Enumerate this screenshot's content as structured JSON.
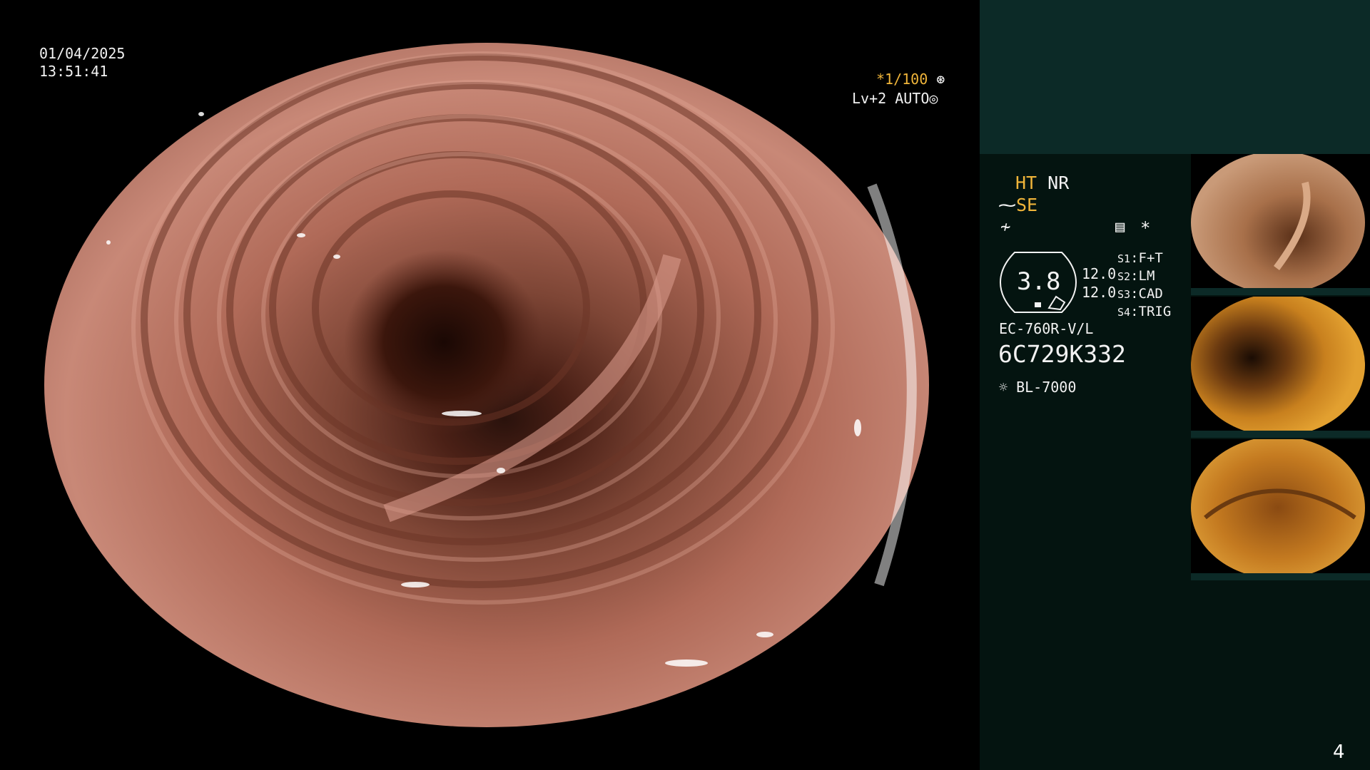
{
  "datetime": {
    "date": "01/04/2025",
    "time": "13:51:41"
  },
  "shutter": {
    "value": "1/100",
    "prefix": "*"
  },
  "level": {
    "label": "Lv+2",
    "mode": "AUTO"
  },
  "image_mode": {
    "ht": "HT",
    "nr": "NR",
    "se": "SE"
  },
  "zoom_value": "3.8",
  "scale_values": [
    "12.0",
    "12.0"
  ],
  "switches": [
    {
      "key": "S1",
      "value": "F+T"
    },
    {
      "key": "S2",
      "value": "LM"
    },
    {
      "key": "S3",
      "value": "CAD"
    },
    {
      "key": "S4",
      "value": "TRIG"
    }
  ],
  "scope_model": "EC-760R-V/L",
  "serial": "6C729K332",
  "light_source": "BL-7000",
  "page_number": "4",
  "colors": {
    "panel_bg": "#041410",
    "panel_top": "#0c2a27",
    "amber": "#f0b53a"
  }
}
